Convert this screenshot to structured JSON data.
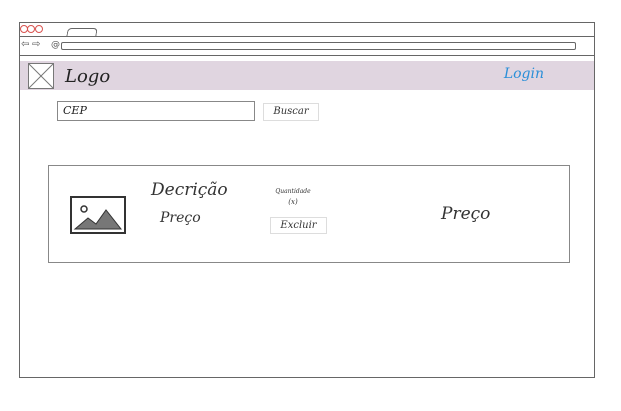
{
  "header": {
    "logo_text": "Logo",
    "login_label": "Login",
    "background_color": "#e0d5e0",
    "login_color": "#2a8fd8"
  },
  "search": {
    "cep_value": "CEP",
    "buscar_label": "Buscar"
  },
  "product": {
    "description": "Decrição",
    "unit_price_label": "Preço",
    "quantity_label": "Quantidade",
    "quantity_value": "(x)",
    "delete_label": "Excluir",
    "total_price_label": "Preço"
  }
}
